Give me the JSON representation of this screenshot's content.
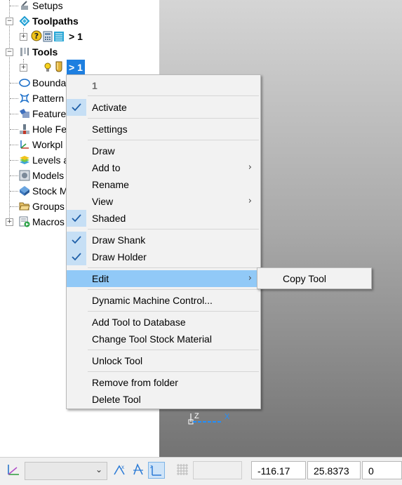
{
  "tree": {
    "items": [
      {
        "label": "Setups",
        "bold": false
      },
      {
        "label": "Toolpaths",
        "bold": true
      },
      {
        "label": "> 1",
        "bold": true
      },
      {
        "label": "Tools",
        "bold": true
      },
      {
        "label": "> 1",
        "bold": true,
        "selected": true
      },
      {
        "label": "Bounda",
        "bold": false
      },
      {
        "label": "Pattern",
        "bold": false
      },
      {
        "label": "Feature",
        "bold": false
      },
      {
        "label": "Hole Fe",
        "bold": false
      },
      {
        "label": "Workpl",
        "bold": false
      },
      {
        "label": "Levels a",
        "bold": false
      },
      {
        "label": "Models",
        "bold": false
      },
      {
        "label": "Stock M",
        "bold": false
      },
      {
        "label": "Groups",
        "bold": false
      },
      {
        "label": "Macros",
        "bold": false
      }
    ]
  },
  "context_menu": {
    "header": "1",
    "items": {
      "activate": "Activate",
      "settings": "Settings",
      "draw": "Draw",
      "add_to": "Add to",
      "rename": "Rename",
      "view": "View",
      "shaded": "Shaded",
      "draw_shank": "Draw Shank",
      "draw_holder": "Draw Holder",
      "edit": "Edit",
      "dynamic_machine_control": "Dynamic Machine Control...",
      "add_tool_to_database": "Add Tool to Database",
      "change_tool_stock_material": "Change Tool Stock Material",
      "unlock_tool": "Unlock Tool",
      "remove_from_folder": "Remove from folder",
      "delete_tool": "Delete Tool"
    },
    "submenu_arrow": "›"
  },
  "submenu": {
    "copy_tool": "Copy Tool"
  },
  "viewport": {
    "axis_z": "Z",
    "axis_x": "X"
  },
  "statusbar": {
    "combo_value": "",
    "combo_chevron": "⌄",
    "x_value": "-116.17",
    "y_value": "25.8373",
    "z_value": "0"
  },
  "colors": {
    "selection": "#1e7fe0",
    "menu_highlight": "#91c9f7",
    "check_background": "#c6dff5"
  }
}
